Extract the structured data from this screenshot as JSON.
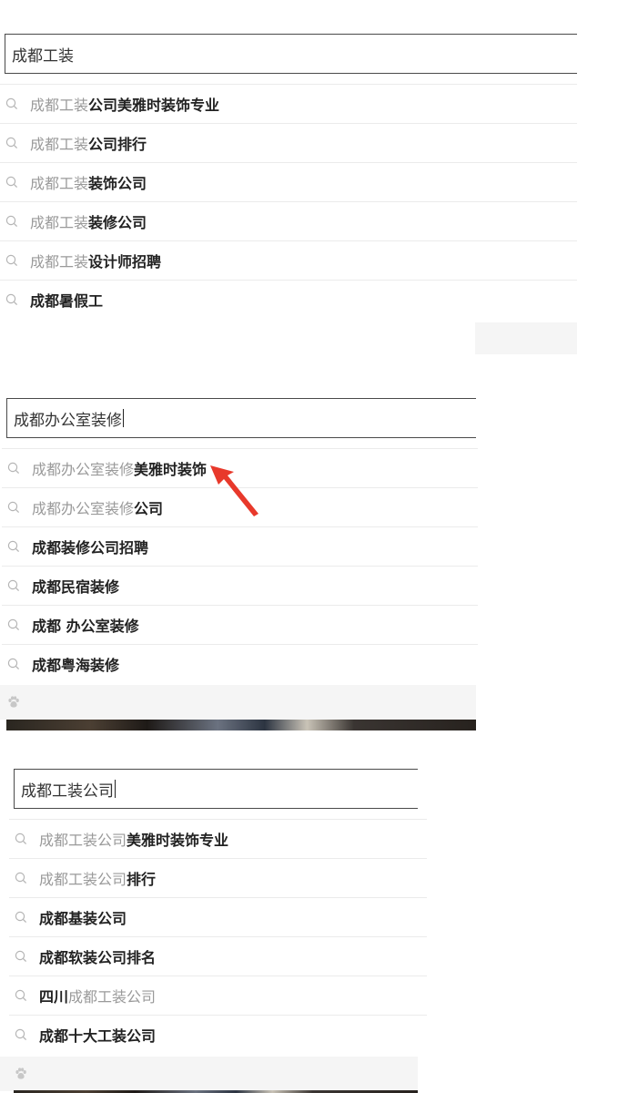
{
  "panels": [
    {
      "query": "成都工装",
      "caret_visible": false,
      "suggestions": [
        {
          "typed": "成都工装",
          "rest": "公司美雅时装饰专业"
        },
        {
          "typed": "成都工装",
          "rest": "公司排行"
        },
        {
          "typed": "成都工装",
          "rest": "装饰公司"
        },
        {
          "typed": "成都工装",
          "rest": "装修公司"
        },
        {
          "typed": "成都工装",
          "rest": "设计师招聘"
        },
        {
          "typed": "",
          "rest": "成都暑假工"
        }
      ]
    },
    {
      "query": "成都办公室装修",
      "caret_visible": true,
      "suggestions": [
        {
          "typed": "成都办公室装修",
          "rest": "美雅时装饰"
        },
        {
          "typed": "成都办公室装修",
          "rest": "公司"
        },
        {
          "typed": "",
          "rest": "成都装修公司招聘"
        },
        {
          "typed": "",
          "rest": "成都民宿装修"
        },
        {
          "typed": "",
          "rest": "成都 办公室装修"
        },
        {
          "typed": "",
          "rest": "成都粤海装修"
        }
      ]
    },
    {
      "query": "成都工装公司",
      "caret_visible": true,
      "suggestions": [
        {
          "typed": "成都工装公司",
          "rest": "美雅时装饰专业"
        },
        {
          "typed": "成都工装公司",
          "rest": "排行"
        },
        {
          "typed": "",
          "rest": "成都基装公司"
        },
        {
          "typed": "",
          "rest": "成都软装公司排名"
        },
        {
          "prefix_bold": "四川",
          "typed": "成都工装公司",
          "rest": ""
        },
        {
          "typed": "",
          "rest": "成都十大工装公司"
        }
      ]
    }
  ],
  "icons": {
    "suggestion": "search-icon",
    "footer": "baidu-paw-icon",
    "annotation": "red-arrow-icon"
  },
  "colors": {
    "arrow": "#e8392b",
    "typed_text": "#9a9a9a",
    "bold_text": "#222222"
  }
}
